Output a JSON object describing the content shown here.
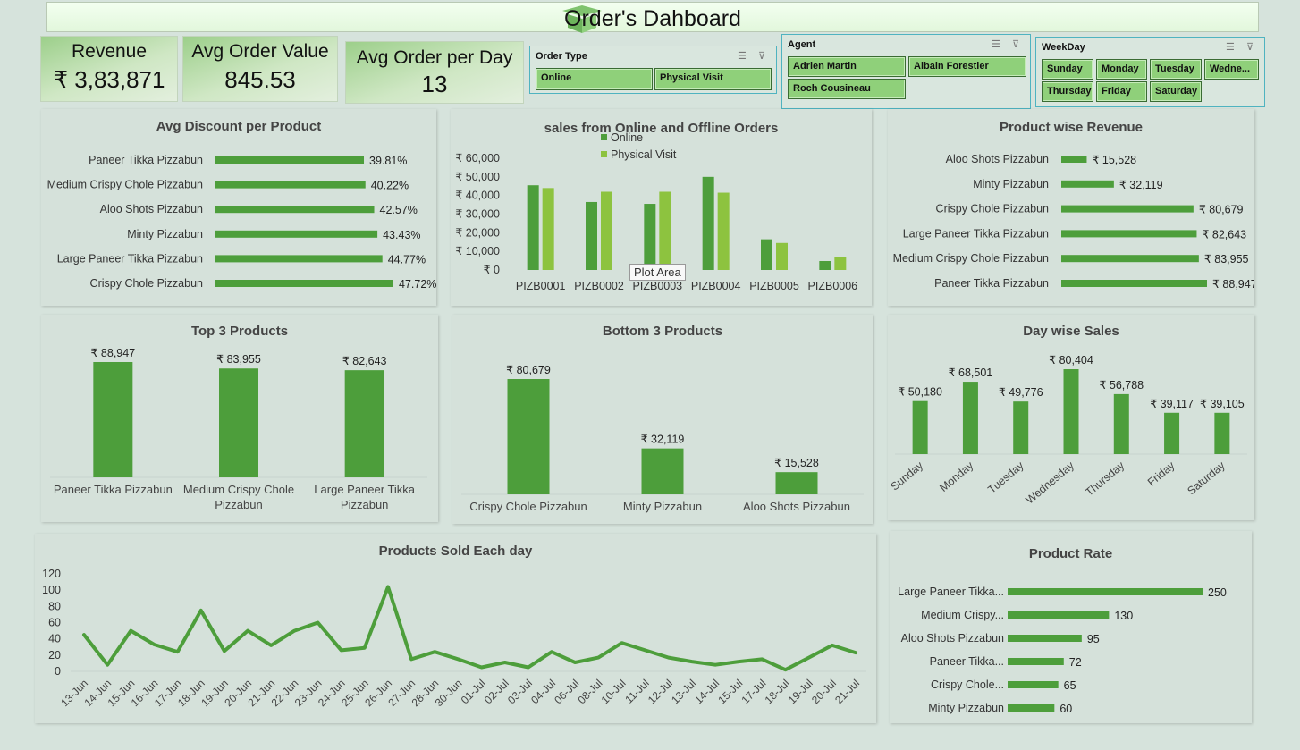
{
  "dashboard": {
    "title": "Order's Dahboard"
  },
  "kpis": [
    {
      "label": "Revenue",
      "value": "₹ 3,83,871"
    },
    {
      "label": "Avg Order Value",
      "value": "845.53"
    },
    {
      "label": "Avg Order per Day",
      "value": "13"
    }
  ],
  "slicers": {
    "order_type": {
      "title": "Order Type",
      "items": [
        "Online",
        "Physical Visit"
      ]
    },
    "agent": {
      "title": "Agent",
      "items": [
        "Adrien Martin",
        "Albain Forestier",
        "Roch Cousineau"
      ]
    },
    "weekday": {
      "title": "WeekDay",
      "items": [
        "Sunday",
        "Monday",
        "Tuesday",
        "Wedne...",
        "Thursday",
        "Friday",
        "Saturday"
      ]
    }
  },
  "tooltip": "Plot Area",
  "colors": {
    "dark_green": "#4d9e3b",
    "light_green": "#8dc33f"
  },
  "chart_data": [
    {
      "id": "avg_discount",
      "type": "bar",
      "orientation": "horizontal",
      "title": "Avg Discount per Product",
      "categories": [
        "Paneer Tikka Pizzabun",
        "Medium Crispy Chole Pizzabun",
        "Aloo Shots Pizzabun",
        "Minty Pizzabun",
        "Large Paneer Tikka Pizzabun",
        "Crispy Chole Pizzabun"
      ],
      "values": [
        39.81,
        40.22,
        42.57,
        43.43,
        44.77,
        47.72
      ],
      "labels": [
        "39.81%",
        "40.22%",
        "42.57%",
        "43.43%",
        "44.77%",
        "47.72%"
      ]
    },
    {
      "id": "online_offline",
      "type": "bar",
      "title": "sales from Online and Offline Orders",
      "categories": [
        "PIZB0001",
        "PIZB0002",
        "PIZB0003",
        "PIZB0004",
        "PIZB0005",
        "PIZB0006"
      ],
      "series": [
        {
          "name": "Online",
          "values": [
            45500,
            36500,
            35500,
            50000,
            16500,
            4800
          ]
        },
        {
          "name": "Physical Visit",
          "values": [
            44000,
            42000,
            42000,
            41500,
            14500,
            7200
          ]
        }
      ],
      "ytick_labels": [
        "₹ 0",
        "₹ 10,000",
        "₹ 20,000",
        "₹ 30,000",
        "₹ 40,000",
        "₹ 50,000",
        "₹ 60,000"
      ],
      "ylim": [
        0,
        60000
      ],
      "legend": "top"
    },
    {
      "id": "product_revenue",
      "type": "bar",
      "orientation": "horizontal",
      "title": "Product wise Revenue",
      "categories": [
        "Aloo Shots Pizzabun",
        "Minty Pizzabun",
        "Crispy Chole Pizzabun",
        "Large Paneer Tikka Pizzabun",
        "Medium Crispy Chole Pizzabun",
        "Paneer Tikka Pizzabun"
      ],
      "values": [
        15528,
        32119,
        80679,
        82643,
        83955,
        88947
      ],
      "labels": [
        "₹ 15,528",
        "₹ 32,119",
        "₹ 80,679",
        "₹ 82,643",
        "₹ 83,955",
        "₹ 88,947"
      ]
    },
    {
      "id": "top3",
      "type": "bar",
      "title": "Top 3 Products",
      "categories": [
        "Paneer Tikka Pizzabun",
        "Medium Crispy Chole Pizzabun",
        "Large Paneer Tikka Pizzabun"
      ],
      "values": [
        88947,
        83955,
        82643
      ],
      "labels": [
        "₹ 88,947",
        "₹ 83,955",
        "₹ 82,643"
      ]
    },
    {
      "id": "bottom3",
      "type": "bar",
      "title": "Bottom 3 Products",
      "categories": [
        "Crispy Chole Pizzabun",
        "Minty Pizzabun",
        "Aloo Shots Pizzabun"
      ],
      "values": [
        80679,
        32119,
        15528
      ],
      "labels": [
        "₹ 80,679",
        "₹ 32,119",
        "₹ 15,528"
      ]
    },
    {
      "id": "day_sales",
      "type": "bar",
      "title": "Day wise Sales",
      "categories": [
        "Sunday",
        "Monday",
        "Tuesday",
        "Wednesday",
        "Thursday",
        "Friday",
        "Saturday"
      ],
      "values": [
        50180,
        68501,
        49776,
        80404,
        56788,
        39117,
        39105
      ],
      "labels": [
        "₹ 50,180",
        "₹ 68,501",
        "₹ 49,776",
        "₹ 80,404",
        "₹ 56,788",
        "₹ 39,117",
        "₹ 39,105"
      ]
    },
    {
      "id": "products_sold",
      "type": "line",
      "title": "Products Sold Each day",
      "x": [
        "13-Jun",
        "14-Jun",
        "15-Jun",
        "16-Jun",
        "17-Jun",
        "18-Jun",
        "19-Jun",
        "20-Jun",
        "21-Jun",
        "22-Jun",
        "23-Jun",
        "24-Jun",
        "25-Jun",
        "26-Jun",
        "27-Jun",
        "28-Jun",
        "30-Jun",
        "01-Jul",
        "02-Jul",
        "03-Jul",
        "04-Jul",
        "06-Jul",
        "08-Jul",
        "10-Jul",
        "11-Jul",
        "12-Jul",
        "13-Jul",
        "14-Jul",
        "15-Jul",
        "17-Jul",
        "18-Jul",
        "19-Jul",
        "20-Jul",
        "21-Jul"
      ],
      "values": [
        45,
        8,
        50,
        33,
        24,
        75,
        25,
        50,
        32,
        50,
        60,
        26,
        29,
        104,
        15,
        24,
        15,
        5,
        11,
        5,
        24,
        11,
        17,
        35,
        26,
        17,
        12,
        8,
        12,
        15,
        2,
        17,
        32,
        23
      ],
      "ytick_labels": [
        "0",
        "20",
        "40",
        "60",
        "80",
        "100",
        "120"
      ],
      "ylim": [
        0,
        120
      ]
    },
    {
      "id": "product_rate",
      "type": "bar",
      "orientation": "horizontal",
      "title": "Product Rate",
      "categories": [
        "Large Paneer Tikka...",
        "Medium Crispy...",
        "Aloo Shots Pizzabun",
        "Paneer Tikka...",
        "Crispy Chole...",
        "Minty Pizzabun"
      ],
      "values": [
        250,
        130,
        95,
        72,
        65,
        60
      ],
      "labels": [
        "250",
        "130",
        "95",
        "72",
        "65",
        "60"
      ]
    }
  ]
}
